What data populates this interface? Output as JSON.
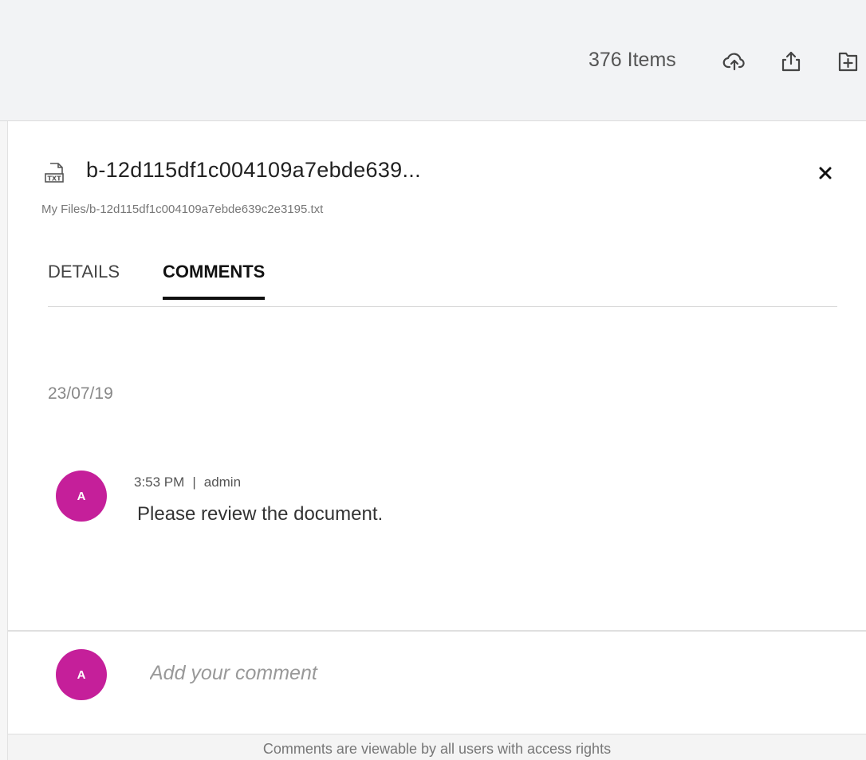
{
  "header": {
    "item_count": "376 Items",
    "icons": [
      "cloud-upload-icon",
      "share-export-icon",
      "new-folder-icon"
    ]
  },
  "panel": {
    "file_type_icon": "txt-file-icon",
    "file_title": "b-12d115df1c004109a7ebde639...",
    "file_path": "My Files/b-12d115df1c004109a7ebde639c2e3195.txt",
    "close_icon": "close-icon",
    "tabs": [
      {
        "label": "DETAILS",
        "active": false
      },
      {
        "label": "COMMENTS",
        "active": true
      }
    ]
  },
  "comments": {
    "groups": [
      {
        "date": "23/07/19",
        "items": [
          {
            "avatar_initial": "A",
            "time": "3:53 PM",
            "separator": "|",
            "author": "admin",
            "text": "Please review the document."
          }
        ]
      }
    ]
  },
  "composer": {
    "avatar_initial": "A",
    "placeholder": "Add your comment",
    "value": ""
  },
  "footer": {
    "notice": "Comments are viewable by all users with access rights"
  },
  "colors": {
    "avatar": "#c51f9a",
    "active_tab_underline": "#111111",
    "header_bg": "#f2f3f5"
  }
}
